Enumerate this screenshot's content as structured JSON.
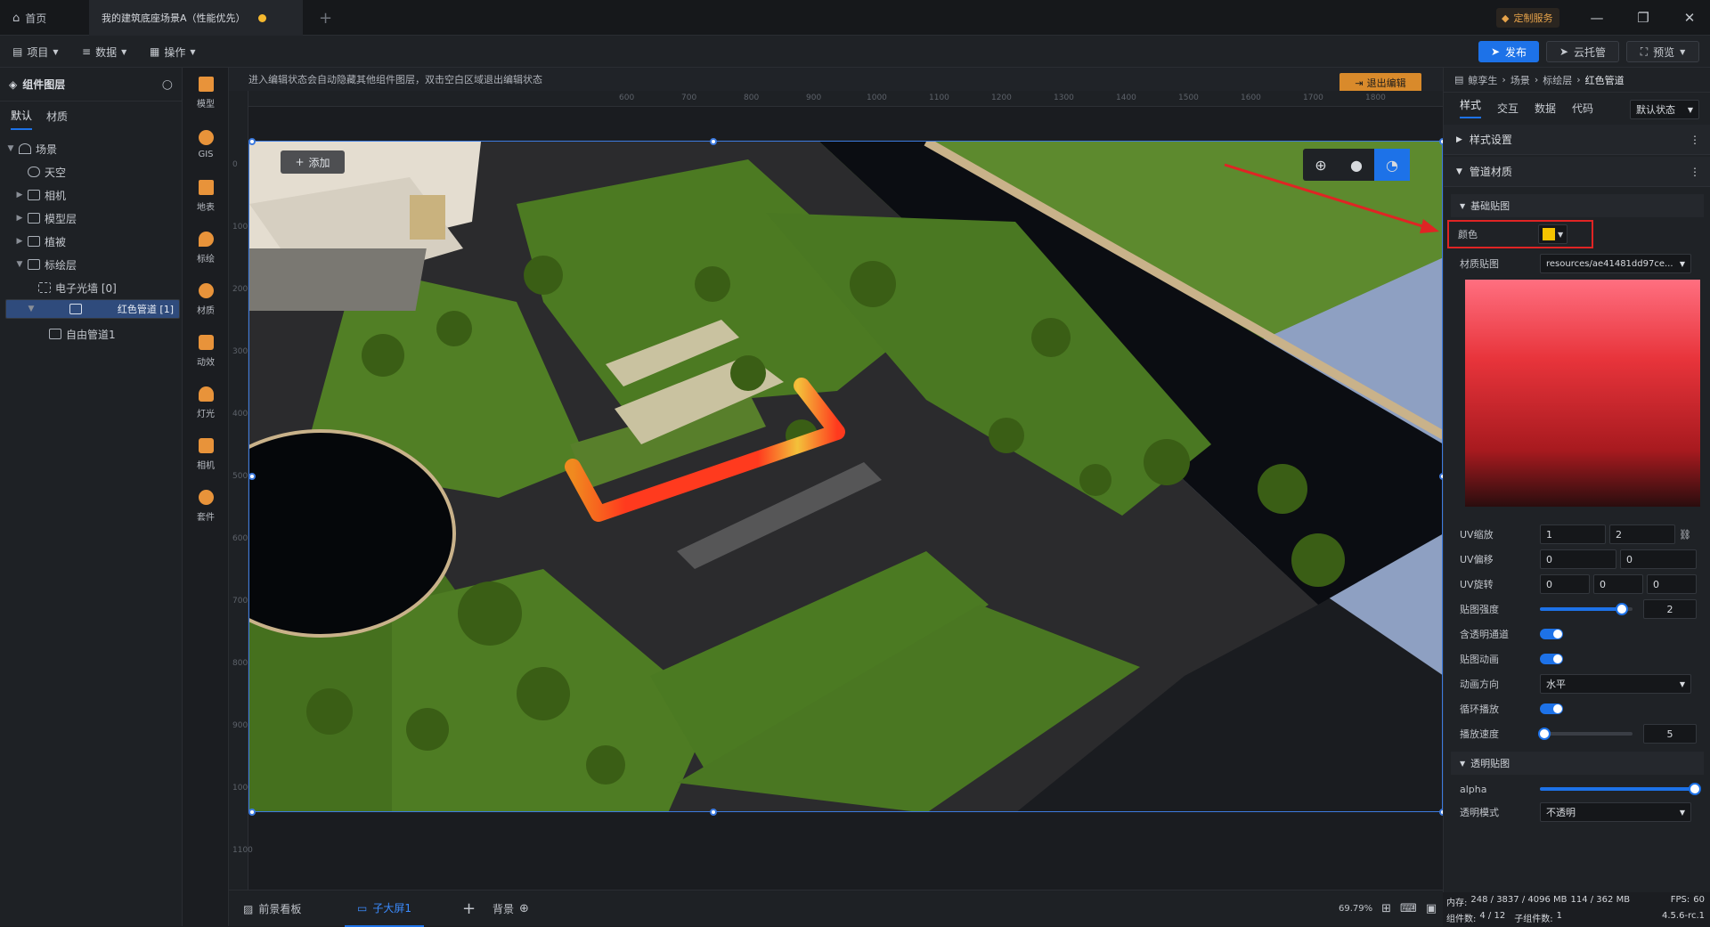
{
  "tabs": {
    "home": "首页",
    "scene_tab": "我的建筑底座场景A（性能优先）"
  },
  "titlebar": {
    "custom_service": "定制服务"
  },
  "menubar": {
    "project": "项目",
    "data": "数据",
    "operate": "操作",
    "publish": "发布",
    "cloud": "云托管",
    "preview": "预览"
  },
  "left_panel": {
    "title": "组件图层",
    "tabs": [
      "默认",
      "材质"
    ],
    "tree": [
      {
        "label": "场景"
      },
      {
        "label": "天空"
      },
      {
        "label": "相机"
      },
      {
        "label": "模型层"
      },
      {
        "label": "植被"
      },
      {
        "label": "标绘层"
      },
      {
        "label": "电子光墙 [0]"
      },
      {
        "label": "红色管道 [1]"
      },
      {
        "label": "自由管道1"
      }
    ]
  },
  "rail": [
    {
      "label": "模型"
    },
    {
      "label": "GIS"
    },
    {
      "label": "地表"
    },
    {
      "label": "标绘"
    },
    {
      "label": "材质"
    },
    {
      "label": "动效"
    },
    {
      "label": "灯光"
    },
    {
      "label": "相机"
    },
    {
      "label": "套件"
    }
  ],
  "canvas": {
    "hint": "进入编辑状态会自动隐藏其他组件图层，双击空白区域退出编辑状态",
    "exit_edit": "退出编辑",
    "add": "添加",
    "ruler_top": [
      "600",
      "700",
      "800",
      "900",
      "1000",
      "1100",
      "1200",
      "1300",
      "1400",
      "1500",
      "1600",
      "1700",
      "1800"
    ],
    "ruler_left": [
      "0",
      "100",
      "200",
      "300",
      "400",
      "500",
      "600",
      "700",
      "800",
      "900",
      "1000",
      "1100"
    ]
  },
  "bottom": {
    "tab1": "前景看板",
    "tab2": "子大屏1",
    "tab3": "背景",
    "zoom": "69.79%"
  },
  "right_panel": {
    "breadcrumb": [
      "鲸孪生",
      "场景",
      "标绘层",
      "红色管道"
    ],
    "tabs": [
      "样式",
      "交互",
      "数据",
      "代码"
    ],
    "state": "默认状态",
    "sections": {
      "style_settings": "样式设置",
      "pipe_material": "管道材质",
      "basic_map": "基础贴图",
      "alpha_map": "透明贴图"
    },
    "color_label": "颜色",
    "color_value": "#f5c400",
    "texture_label": "材质贴图",
    "texture_value": "resources/ae41481dd97ce...",
    "uv_scale_label": "UV缩放",
    "uv_scale": [
      "1",
      "2"
    ],
    "uv_offset_label": "UV偏移",
    "uv_offset": [
      "0",
      "0"
    ],
    "uv_rotate_label": "UV旋转",
    "uv_rotate": [
      "0",
      "0",
      "0"
    ],
    "map_intensity_label": "贴图强度",
    "map_intensity": "2",
    "map_intensity_level": 0.88,
    "transparent_channel_label": "含透明通道",
    "map_animation_label": "贴图动画",
    "anim_direction_label": "动画方向",
    "anim_direction": "水平",
    "loop_label": "循环播放",
    "speed_label": "播放速度",
    "speed": "5",
    "speed_level": 0.05,
    "alpha_label": "alpha",
    "alpha_level": 1.0,
    "alpha_mode_label": "透明模式",
    "alpha_mode": "不透明"
  },
  "status": {
    "memory_label": "内存:",
    "memory": "248 / 3837 / 4096 MB",
    "gpu": "114 / 362 MB",
    "fps_label": "FPS:",
    "fps": "60",
    "components_label": "组件数:",
    "components": "4 / 12",
    "sub_components_label": "子组件数:",
    "sub_components": "1",
    "version": "4.5.6-rc.1"
  }
}
